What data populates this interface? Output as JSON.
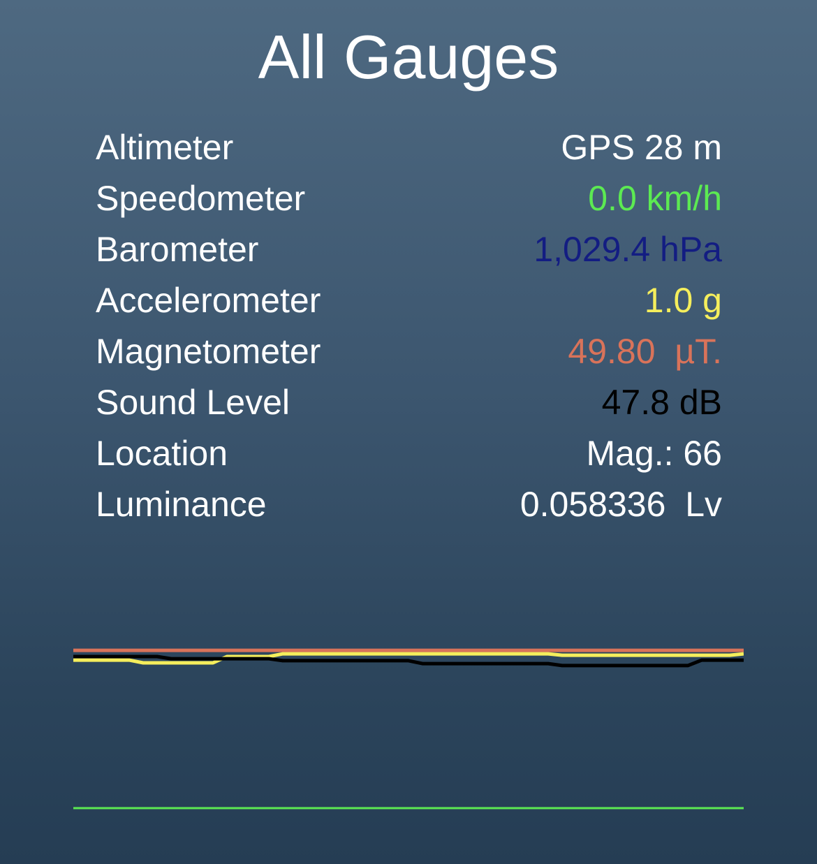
{
  "header": {
    "title": "All Gauges"
  },
  "gauges": [
    {
      "label": "Altimeter",
      "value": "GPS 28 m",
      "color": "#ffffff"
    },
    {
      "label": "Speedometer",
      "value": "0.0 km/h",
      "color": "#5cea52"
    },
    {
      "label": "Barometer",
      "value": "1,029.4 hPa",
      "color": "#131d82"
    },
    {
      "label": "Accelerometer",
      "value": "1.0 g",
      "color": "#f5ee5c"
    },
    {
      "label": "Magnetometer",
      "value": "49.80  µT.",
      "color": "#d9735a"
    },
    {
      "label": "Sound Level",
      "value": "47.8 dB",
      "color": "#000000"
    },
    {
      "label": "Location",
      "value": "Mag.: 66",
      "color": "#ffffff"
    },
    {
      "label": "Luminance",
      "value": "0.058336  Lv",
      "color": "#ffffff"
    }
  ],
  "chart_data": {
    "type": "line",
    "grid": false,
    "ylim": [
      0,
      100
    ],
    "x": [
      0,
      1,
      2,
      3,
      4,
      5,
      6,
      7,
      8,
      9,
      10,
      11,
      12,
      13,
      14,
      15,
      16,
      17,
      18,
      19,
      20,
      21,
      22,
      23,
      24,
      25,
      26,
      27,
      28,
      29,
      30,
      31,
      32,
      33,
      34,
      35,
      36,
      37,
      38,
      39,
      40,
      41,
      42,
      43,
      44,
      45,
      46,
      47,
      48
    ],
    "series": [
      {
        "color": "#d9735a",
        "values": [
          88.9,
          88.9,
          88.9,
          88.9,
          88.9,
          88.9,
          88.9,
          88.9,
          88.9,
          88.9,
          88.9,
          88.9,
          88.9,
          88.9,
          88.9,
          88.9,
          88.9,
          88.9,
          88.9,
          88.9,
          88.9,
          88.9,
          88.9,
          88.9,
          88.9,
          88.9,
          88.9,
          88.9,
          88.9,
          88.9,
          88.9,
          88.9,
          88.9,
          88.9,
          88.9,
          88.9,
          88.9,
          88.9,
          88.9,
          88.9,
          88.9,
          88.9,
          88.9,
          88.9,
          88.9,
          88.9,
          88.9,
          88.9,
          88.9
        ]
      },
      {
        "color": "#f5ee5c",
        "values": [
          83.9,
          83.9,
          83.9,
          83.9,
          83.9,
          82.5,
          82.5,
          82.5,
          82.5,
          82.5,
          82.5,
          85.7,
          85.7,
          85.7,
          85.7,
          87.1,
          87.1,
          87.1,
          87.1,
          87.1,
          87.1,
          87.1,
          87.1,
          87.1,
          87.1,
          87.1,
          87.1,
          87.1,
          87.1,
          87.1,
          87.1,
          87.1,
          87.1,
          87.1,
          87.1,
          86.4,
          86.4,
          86.4,
          86.4,
          86.4,
          86.4,
          86.4,
          86.4,
          86.4,
          86.4,
          86.4,
          86.4,
          86.4,
          87.1
        ]
      },
      {
        "color": "#000000",
        "values": [
          85.7,
          85.7,
          85.7,
          85.7,
          85.7,
          85.7,
          85.7,
          84.6,
          84.6,
          84.6,
          84.6,
          84.6,
          84.6,
          84.6,
          84.6,
          83.6,
          83.6,
          83.6,
          83.6,
          83.6,
          83.6,
          83.6,
          83.6,
          83.6,
          83.6,
          82.1,
          82.1,
          82.1,
          82.1,
          82.1,
          82.1,
          82.1,
          82.1,
          82.1,
          82.1,
          81.1,
          81.1,
          81.1,
          81.1,
          81.1,
          81.1,
          81.1,
          81.1,
          81.1,
          81.1,
          83.9,
          83.9,
          83.9,
          83.9
        ]
      },
      {
        "color": "#5cea52",
        "values": [
          8.2,
          8.2,
          8.2,
          8.2,
          8.2,
          8.2,
          8.2,
          8.2,
          8.2,
          8.2,
          8.2,
          8.2,
          8.2,
          8.2,
          8.2,
          8.2,
          8.2,
          8.2,
          8.2,
          8.2,
          8.2,
          8.2,
          8.2,
          8.2,
          8.2,
          8.2,
          8.2,
          8.2,
          8.2,
          8.2,
          8.2,
          8.2,
          8.2,
          8.2,
          8.2,
          8.2,
          8.2,
          8.2,
          8.2,
          8.2,
          8.2,
          8.2,
          8.2,
          8.2,
          8.2,
          8.2,
          8.2,
          8.2,
          8.2
        ]
      }
    ]
  }
}
